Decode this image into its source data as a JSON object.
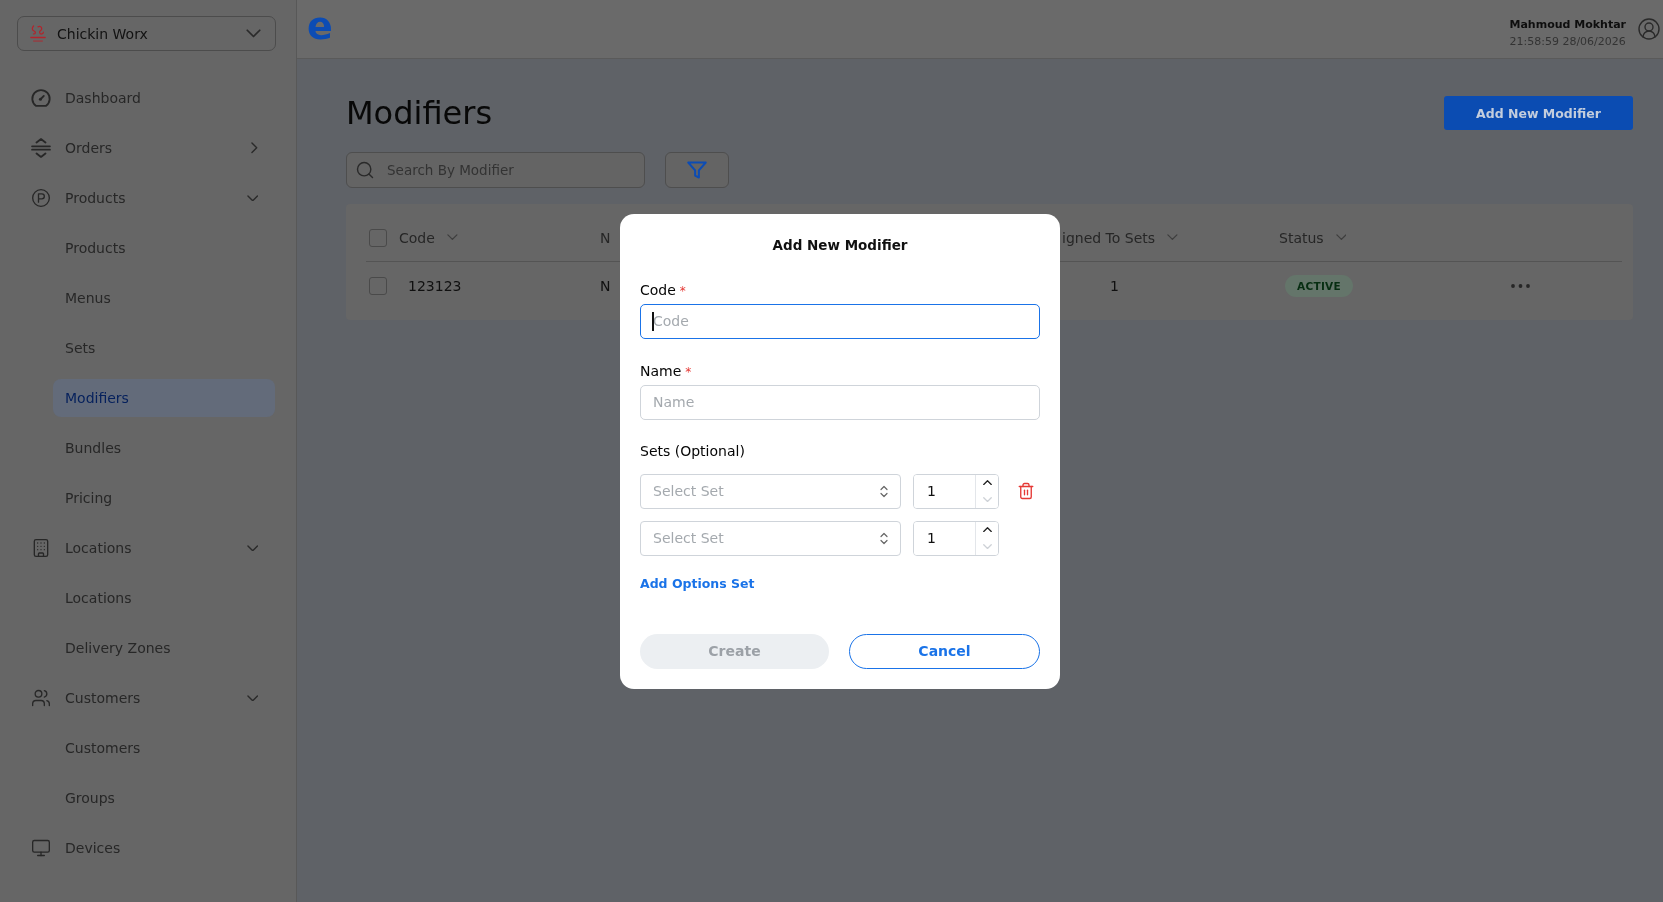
{
  "sidebar": {
    "brand": {
      "name": "Chickin Worx"
    },
    "items": [
      {
        "label": "Dashboard",
        "kind": "link",
        "selected": false
      },
      {
        "label": "Orders",
        "kind": "group",
        "expanded": false,
        "selected": false
      },
      {
        "label": "Products",
        "kind": "group",
        "expanded": true,
        "selected": false,
        "children": [
          {
            "label": "Products",
            "selected": false
          },
          {
            "label": "Menus",
            "selected": false
          },
          {
            "label": "Sets",
            "selected": false
          },
          {
            "label": "Modifiers",
            "selected": true
          },
          {
            "label": "Bundles",
            "selected": false
          },
          {
            "label": "Pricing",
            "selected": false
          }
        ]
      },
      {
        "label": "Locations",
        "kind": "group",
        "expanded": true,
        "selected": false,
        "children": [
          {
            "label": "Locations",
            "selected": false
          },
          {
            "label": "Delivery Zones",
            "selected": false
          }
        ]
      },
      {
        "label": "Customers",
        "kind": "group",
        "expanded": true,
        "selected": false,
        "children": [
          {
            "label": "Customers",
            "selected": false
          },
          {
            "label": "Groups",
            "selected": false
          }
        ]
      },
      {
        "label": "Devices",
        "kind": "link",
        "selected": false
      }
    ]
  },
  "header": {
    "logo": "e",
    "user": {
      "name": "Mahmoud Mokhtar",
      "timestamp": "21:58:59 28/06/2026"
    }
  },
  "page": {
    "title": "Modifiers",
    "add_button": "Add New Modifier",
    "search": {
      "placeholder": "Search By Modifier"
    }
  },
  "table": {
    "select_all": {
      "checked": false
    },
    "columns": [
      {
        "label": "Code",
        "sortable": true
      },
      {
        "label": "N",
        "sortable": false
      },
      {
        "label": "igned To Sets",
        "sortable": true
      },
      {
        "label": "Status",
        "sortable": true
      }
    ],
    "rows": [
      {
        "checked": false,
        "cells": [
          "123123",
          "N",
          "1"
        ],
        "status": "ACTIVE"
      }
    ]
  },
  "modal": {
    "title": "Add New Modifier",
    "fields": [
      {
        "label": "Code",
        "required_mark": "*",
        "placeholder": "Code",
        "focused": true
      },
      {
        "label": "Name",
        "required_mark": "*",
        "placeholder": "Name",
        "focused": false
      }
    ],
    "sets": {
      "label": "Sets (Optional)",
      "rows": [
        {
          "placeholder": "Select Set",
          "quantity": "1",
          "down_disabled": true,
          "removable": true
        },
        {
          "placeholder": "Select Set",
          "quantity": "1",
          "down_disabled": true,
          "removable": false
        }
      ]
    },
    "add_link": "Add Options Set",
    "buttons": [
      {
        "label": "Create",
        "kind": "primary",
        "disabled": true
      },
      {
        "label": "Cancel",
        "kind": "secondary",
        "disabled": false
      }
    ]
  }
}
